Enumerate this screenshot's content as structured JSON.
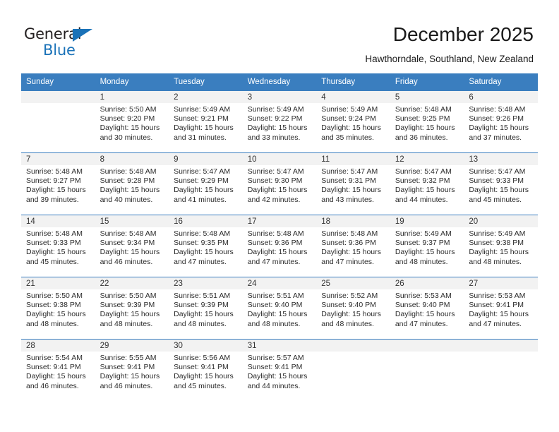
{
  "brand": {
    "name_part1": "General",
    "name_part2": "Blue",
    "triangle_color": "#1a72b8",
    "text_color": "#231f20"
  },
  "header": {
    "title": "December 2025",
    "subtitle": "Hawthorndale, Southland, New Zealand"
  },
  "theme": {
    "header_bg": "#3a7ebf",
    "header_text": "#ffffff",
    "daynum_bg": "#f2f2f2",
    "grid_line": "#3a7ebf",
    "cell_bg": "#ffffff",
    "body_text": "#2b2b2b"
  },
  "weekdays": [
    "Sunday",
    "Monday",
    "Tuesday",
    "Wednesday",
    "Thursday",
    "Friday",
    "Saturday"
  ],
  "labels": {
    "sunrise_prefix": "Sunrise: ",
    "sunset_prefix": "Sunset: ",
    "daylight_prefix": "Daylight: "
  },
  "weeks": [
    [
      {
        "day": "",
        "lines": []
      },
      {
        "day": "1",
        "lines": [
          "Sunrise: 5:50 AM",
          "Sunset: 9:20 PM",
          "Daylight: 15 hours",
          "and 30 minutes."
        ]
      },
      {
        "day": "2",
        "lines": [
          "Sunrise: 5:49 AM",
          "Sunset: 9:21 PM",
          "Daylight: 15 hours",
          "and 31 minutes."
        ]
      },
      {
        "day": "3",
        "lines": [
          "Sunrise: 5:49 AM",
          "Sunset: 9:22 PM",
          "Daylight: 15 hours",
          "and 33 minutes."
        ]
      },
      {
        "day": "4",
        "lines": [
          "Sunrise: 5:49 AM",
          "Sunset: 9:24 PM",
          "Daylight: 15 hours",
          "and 35 minutes."
        ]
      },
      {
        "day": "5",
        "lines": [
          "Sunrise: 5:48 AM",
          "Sunset: 9:25 PM",
          "Daylight: 15 hours",
          "and 36 minutes."
        ]
      },
      {
        "day": "6",
        "lines": [
          "Sunrise: 5:48 AM",
          "Sunset: 9:26 PM",
          "Daylight: 15 hours",
          "and 37 minutes."
        ]
      }
    ],
    [
      {
        "day": "7",
        "lines": [
          "Sunrise: 5:48 AM",
          "Sunset: 9:27 PM",
          "Daylight: 15 hours",
          "and 39 minutes."
        ]
      },
      {
        "day": "8",
        "lines": [
          "Sunrise: 5:48 AM",
          "Sunset: 9:28 PM",
          "Daylight: 15 hours",
          "and 40 minutes."
        ]
      },
      {
        "day": "9",
        "lines": [
          "Sunrise: 5:47 AM",
          "Sunset: 9:29 PM",
          "Daylight: 15 hours",
          "and 41 minutes."
        ]
      },
      {
        "day": "10",
        "lines": [
          "Sunrise: 5:47 AM",
          "Sunset: 9:30 PM",
          "Daylight: 15 hours",
          "and 42 minutes."
        ]
      },
      {
        "day": "11",
        "lines": [
          "Sunrise: 5:47 AM",
          "Sunset: 9:31 PM",
          "Daylight: 15 hours",
          "and 43 minutes."
        ]
      },
      {
        "day": "12",
        "lines": [
          "Sunrise: 5:47 AM",
          "Sunset: 9:32 PM",
          "Daylight: 15 hours",
          "and 44 minutes."
        ]
      },
      {
        "day": "13",
        "lines": [
          "Sunrise: 5:47 AM",
          "Sunset: 9:33 PM",
          "Daylight: 15 hours",
          "and 45 minutes."
        ]
      }
    ],
    [
      {
        "day": "14",
        "lines": [
          "Sunrise: 5:48 AM",
          "Sunset: 9:33 PM",
          "Daylight: 15 hours",
          "and 45 minutes."
        ]
      },
      {
        "day": "15",
        "lines": [
          "Sunrise: 5:48 AM",
          "Sunset: 9:34 PM",
          "Daylight: 15 hours",
          "and 46 minutes."
        ]
      },
      {
        "day": "16",
        "lines": [
          "Sunrise: 5:48 AM",
          "Sunset: 9:35 PM",
          "Daylight: 15 hours",
          "and 47 minutes."
        ]
      },
      {
        "day": "17",
        "lines": [
          "Sunrise: 5:48 AM",
          "Sunset: 9:36 PM",
          "Daylight: 15 hours",
          "and 47 minutes."
        ]
      },
      {
        "day": "18",
        "lines": [
          "Sunrise: 5:48 AM",
          "Sunset: 9:36 PM",
          "Daylight: 15 hours",
          "and 47 minutes."
        ]
      },
      {
        "day": "19",
        "lines": [
          "Sunrise: 5:49 AM",
          "Sunset: 9:37 PM",
          "Daylight: 15 hours",
          "and 48 minutes."
        ]
      },
      {
        "day": "20",
        "lines": [
          "Sunrise: 5:49 AM",
          "Sunset: 9:38 PM",
          "Daylight: 15 hours",
          "and 48 minutes."
        ]
      }
    ],
    [
      {
        "day": "21",
        "lines": [
          "Sunrise: 5:50 AM",
          "Sunset: 9:38 PM",
          "Daylight: 15 hours",
          "and 48 minutes."
        ]
      },
      {
        "day": "22",
        "lines": [
          "Sunrise: 5:50 AM",
          "Sunset: 9:39 PM",
          "Daylight: 15 hours",
          "and 48 minutes."
        ]
      },
      {
        "day": "23",
        "lines": [
          "Sunrise: 5:51 AM",
          "Sunset: 9:39 PM",
          "Daylight: 15 hours",
          "and 48 minutes."
        ]
      },
      {
        "day": "24",
        "lines": [
          "Sunrise: 5:51 AM",
          "Sunset: 9:40 PM",
          "Daylight: 15 hours",
          "and 48 minutes."
        ]
      },
      {
        "day": "25",
        "lines": [
          "Sunrise: 5:52 AM",
          "Sunset: 9:40 PM",
          "Daylight: 15 hours",
          "and 48 minutes."
        ]
      },
      {
        "day": "26",
        "lines": [
          "Sunrise: 5:53 AM",
          "Sunset: 9:40 PM",
          "Daylight: 15 hours",
          "and 47 minutes."
        ]
      },
      {
        "day": "27",
        "lines": [
          "Sunrise: 5:53 AM",
          "Sunset: 9:41 PM",
          "Daylight: 15 hours",
          "and 47 minutes."
        ]
      }
    ],
    [
      {
        "day": "28",
        "lines": [
          "Sunrise: 5:54 AM",
          "Sunset: 9:41 PM",
          "Daylight: 15 hours",
          "and 46 minutes."
        ]
      },
      {
        "day": "29",
        "lines": [
          "Sunrise: 5:55 AM",
          "Sunset: 9:41 PM",
          "Daylight: 15 hours",
          "and 46 minutes."
        ]
      },
      {
        "day": "30",
        "lines": [
          "Sunrise: 5:56 AM",
          "Sunset: 9:41 PM",
          "Daylight: 15 hours",
          "and 45 minutes."
        ]
      },
      {
        "day": "31",
        "lines": [
          "Sunrise: 5:57 AM",
          "Sunset: 9:41 PM",
          "Daylight: 15 hours",
          "and 44 minutes."
        ]
      },
      {
        "day": "",
        "lines": []
      },
      {
        "day": "",
        "lines": []
      },
      {
        "day": "",
        "lines": []
      }
    ]
  ]
}
